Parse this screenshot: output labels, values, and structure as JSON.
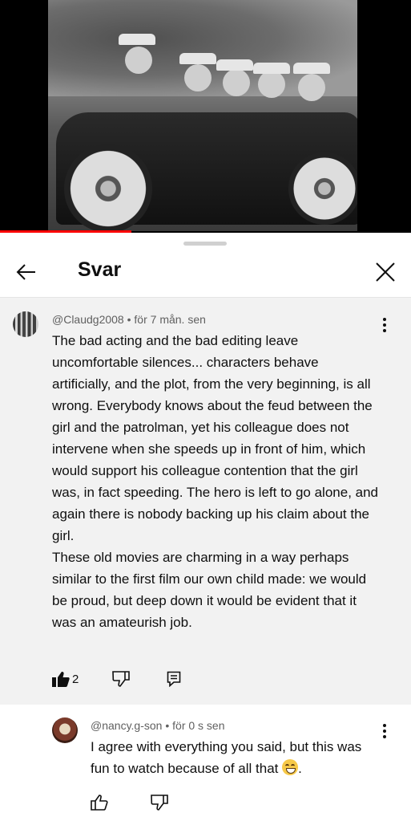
{
  "video": {
    "progress_fraction": 0.32
  },
  "sheet": {
    "title": "Svar"
  },
  "comment": {
    "author": "@Claudg2008",
    "separator": "•",
    "time": "för 7 mån. sen",
    "paragraphs": [
      "The bad acting and the bad editing leave uncomfortable silences... characters behave artificially, and the plot, from the very beginning, is all wrong. Everybody knows about the feud between the girl and the patrolman, yet his colleague does not intervene when she speeds up in front of him, which would support his colleague contention that the girl was, in fact speeding.  The hero is left to go alone, and again there is nobody backing up his claim about the girl.",
      "These old movies are charming in a way perhaps similar to the first film our own child made: we would be proud, but deep down it would be evident that it was an amateurish job."
    ],
    "likes": "2"
  },
  "reply": {
    "author": "@nancy.g-son",
    "separator": "•",
    "time": "för 0 s sen",
    "text": "I agree with everything you said, but this was fun to watch because of all that",
    "text_end": "."
  },
  "colors": {
    "progress": "#ff0000",
    "thread_bg": "#f2f2f2"
  },
  "icons": [
    "back-arrow-icon",
    "close-icon",
    "more-vert-icon",
    "thumb-up-filled-icon",
    "thumb-down-icon",
    "reply-icon",
    "thumb-up-icon",
    "grinning-emoji"
  ]
}
